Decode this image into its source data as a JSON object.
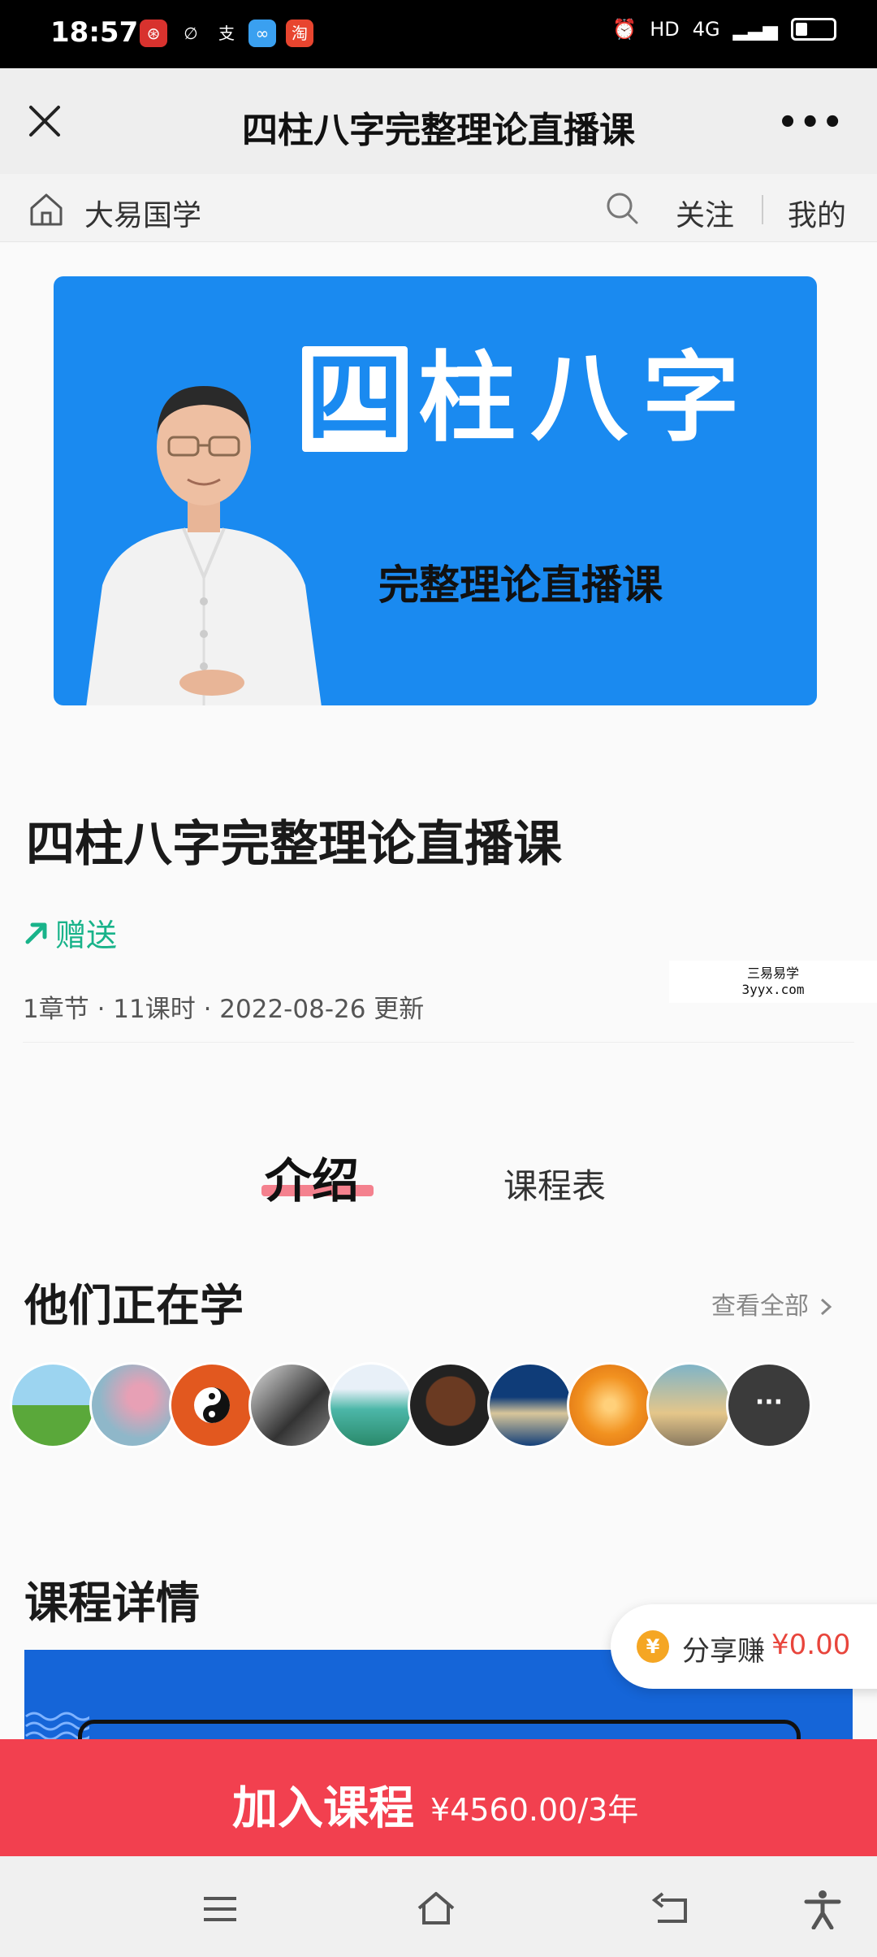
{
  "status_bar": {
    "time": "18:57",
    "notification_icons": [
      "bank-icon",
      "link-icon",
      "alipay-icon",
      "cloud-icon",
      "taobao-icon"
    ],
    "network": "4G",
    "hd": "HD"
  },
  "title_bar": {
    "title": "四柱八字完整理论直播课",
    "close_icon": "close-icon",
    "more_icon": "more-icon",
    "more_label": "•••"
  },
  "shop_bar": {
    "shop_name": "大易国学",
    "follow_label": "关注",
    "mine_label": "我的"
  },
  "banner": {
    "big_chars": [
      "四",
      "柱",
      "八",
      "字"
    ],
    "subtitle": "完整理论直播课",
    "colors": {
      "background": "#1a8af0"
    }
  },
  "course": {
    "title": "四柱八字完整理论直播课",
    "gift_label": "赠送",
    "meta": "1章节 · 11课时 · 2022-08-26 更新"
  },
  "watermark": {
    "line1": "三易易学",
    "line2": "3yyx.com"
  },
  "tabs": {
    "intro": "介绍",
    "schedule": "课程表"
  },
  "learners": {
    "title": "他们正在学",
    "view_all": "查看全部",
    "more_label": "···",
    "avatars": [
      "landscape-tree",
      "peach-blossom",
      "bagua",
      "ink-painting",
      "waterfall",
      "man-portrait",
      "sailing-ship",
      "goldfish",
      "sunset-lake"
    ]
  },
  "details": {
    "title": "课程详情"
  },
  "share": {
    "coin": "¥",
    "label": "分享赚",
    "amount": "¥0.00"
  },
  "join": {
    "label": "加入课程",
    "price": "¥4560.00/3年",
    "colors": {
      "background": "#f2404f"
    }
  },
  "nav": [
    "menu-icon",
    "home-icon",
    "back-icon",
    "accessibility-icon"
  ]
}
